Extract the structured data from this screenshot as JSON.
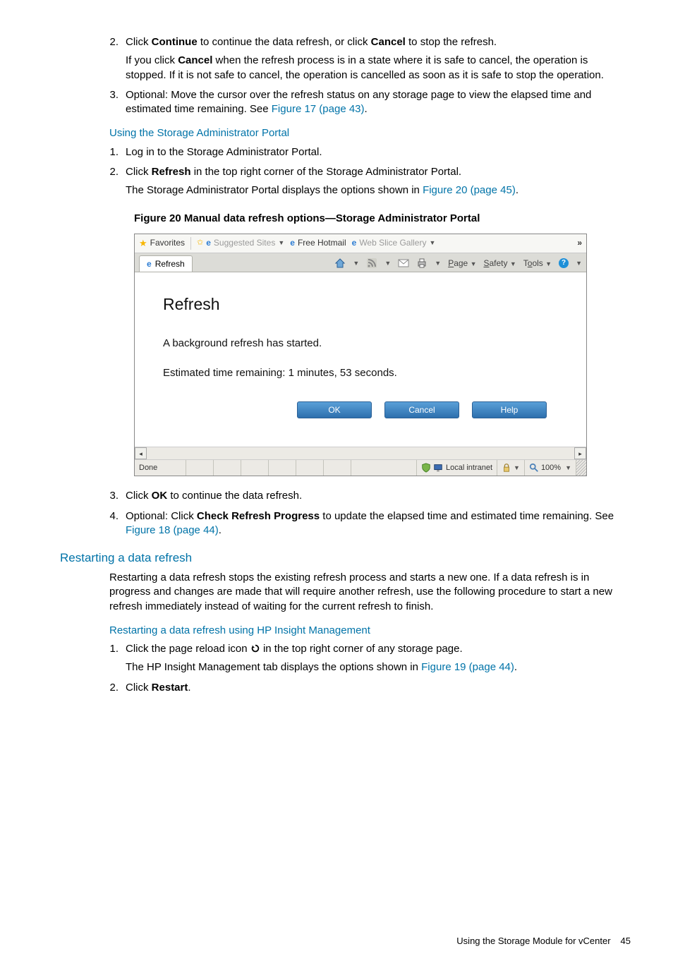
{
  "steps_a": {
    "s2_a": "Click ",
    "s2_b": "Continue",
    "s2_c": " to continue the data refresh, or click ",
    "s2_d": "Cancel",
    "s2_e": " to stop the refresh.",
    "s2p_a": "If you click ",
    "s2p_b": "Cancel",
    "s2p_c": " when the refresh process is in a state where it is safe to cancel, the operation is stopped. If it is not safe to cancel, the operation is cancelled as soon as it is safe to stop the operation.",
    "s3_a": "Optional: Move the cursor over the refresh status on any storage page to view the elapsed time and estimated time remaining. See ",
    "s3_link": "Figure 17 (page 43)",
    "s3_b": "."
  },
  "sec1_title": "Using the Storage Administrator Portal",
  "steps_b": {
    "s1": "Log in to the Storage Administrator Portal.",
    "s2_a": "Click ",
    "s2_b": "Refresh",
    "s2_c": " in the top right corner of the Storage Administrator Portal.",
    "s2p_a": "The Storage Administrator Portal displays the options shown in ",
    "s2p_link": "Figure 20 (page 45)",
    "s2p_b": "."
  },
  "figure_caption": "Figure 20 Manual data refresh options—Storage Administrator Portal",
  "ie": {
    "favorites": "Favorites",
    "suggested": "Suggested Sites",
    "hotmail": "Free Hotmail",
    "gallery": "Web Slice Gallery",
    "tab": "Refresh",
    "menu_page": "Page",
    "menu_safety": "Safety",
    "menu_tools": "Tools",
    "heading": "Refresh",
    "line1": "A background refresh has started.",
    "line2": "Estimated time remaining: 1 minutes, 53 seconds.",
    "btn_ok": "OK",
    "btn_cancel": "Cancel",
    "btn_help": "Help",
    "status_done": "Done",
    "status_zone": "Local intranet",
    "status_zoom": "100%"
  },
  "steps_c": {
    "s3_a": "Click ",
    "s3_b": "OK",
    "s3_c": " to continue the data refresh.",
    "s4_a": "Optional: Click ",
    "s4_b": "Check Refresh Progress",
    "s4_c": " to update the elapsed time and estimated time remaining. See ",
    "s4_link": "Figure 18 (page 44)",
    "s4_d": "."
  },
  "sec2_title": "Restarting a data refresh",
  "sec2_body": "Restarting a data refresh stops the existing refresh process and starts a new one. If a data refresh is in progress and changes are made that will require another refresh, use the following procedure to start a new refresh immediately instead of waiting for the current refresh to finish.",
  "sec3_title": "Restarting a data refresh using HP Insight Management",
  "steps_d": {
    "s1_a": "Click the page reload icon ",
    "s1_b": " in the top right corner of any storage page.",
    "s1p_a": "The HP Insight Management tab displays the options shown in ",
    "s1p_link": "Figure 19 (page 44)",
    "s1p_b": ".",
    "s2_a": "Click ",
    "s2_b": "Restart",
    "s2_c": "."
  },
  "footer_text": "Using the Storage Module for vCenter",
  "footer_page": "45"
}
